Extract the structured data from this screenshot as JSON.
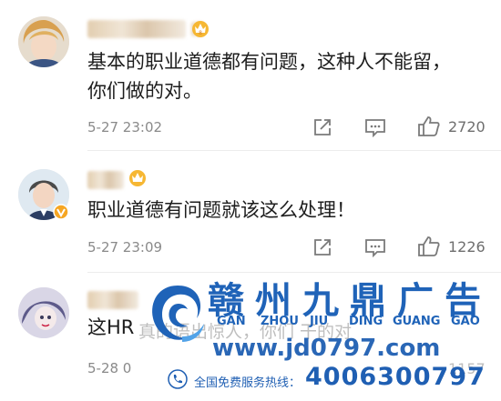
{
  "comments": [
    {
      "text": "基本的职业道德都有问题，这种人不能留，\n你们做的对。",
      "time": "5-27 23:02",
      "likes": "2720"
    },
    {
      "text": "职业道德有问题就该这么处理！",
      "time": "5-27 23:09",
      "likes": "1226"
    },
    {
      "text": "这HR",
      "time": "5-28 0",
      "likes": "1157"
    }
  ],
  "icons": {
    "share": "share-icon",
    "comment": "comment-icon",
    "like": "thumbs-up-icon",
    "crown": "crown-badge-icon",
    "verified": "verified-v-icon"
  },
  "watermark": {
    "title": "赣州九鼎广告",
    "pinyin": [
      "GAN",
      "ZHOU",
      "JIU",
      "DING",
      "GUANG",
      "GAO"
    ],
    "url": "www.jd0797.com",
    "hotline_label": "全国免费服务热线：",
    "hotline_number": "4006300797",
    "obscured_text": "真的语出惊人，你们 干的对"
  },
  "colors": {
    "watermark_blue": "#1f63b8",
    "crown_gold": "#f0a020",
    "meta_gray": "#8a8a8a"
  }
}
